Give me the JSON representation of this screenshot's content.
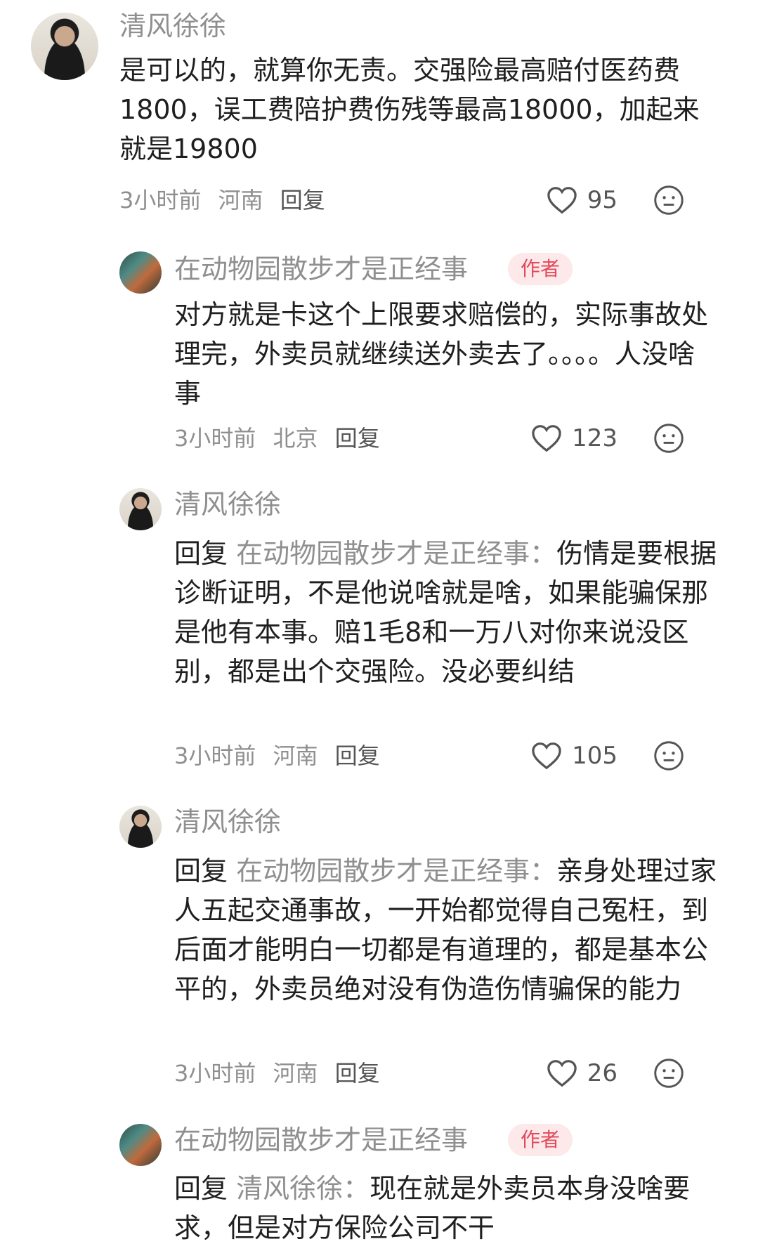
{
  "comments": [
    {
      "user": "清风徐徐",
      "text": "是可以的，就算你无责。交强险最高赔付医药费1800，误工费陪护费伤残等最高18000，加起来就是19800",
      "time": "3小时前",
      "location": "河南",
      "reply_label": "回复",
      "likes": "95"
    },
    {
      "user": "在动物园散步才是正经事",
      "badge": "作者",
      "text": "对方就是卡这个上限要求赔偿的，实际事故处理完，外卖员就继续送外卖去了。。。。人没啥事",
      "time": "3小时前",
      "location": "北京",
      "reply_label": "回复",
      "likes": "123"
    },
    {
      "user": "清风徐徐",
      "reply_prefix": "回复",
      "reply_target": "在动物园散步才是正经事：",
      "text": "伤情是要根据诊断证明，不是他说啥就是啥，如果能骗保那是他有本事。赔1毛8和一万八对你来说没区别，都是出个交强险。没必要纠结",
      "time": "3小时前",
      "location": "河南",
      "reply_label": "回复",
      "likes": "105"
    },
    {
      "user": "清风徐徐",
      "reply_prefix": "回复",
      "reply_target": "在动物园散步才是正经事：",
      "text": "亲身处理过家人五起交通事故，一开始都觉得自己冤枉，到后面才能明白一切都是有道理的，都是基本公平的，外卖员绝对没有伪造伤情骗保的能力",
      "time": "3小时前",
      "location": "河南",
      "reply_label": "回复",
      "likes": "26"
    },
    {
      "user": "在动物园散步才是正经事",
      "badge": "作者",
      "reply_prefix": "回复",
      "reply_target": "清风徐徐：",
      "text": "现在就是外卖员本身没啥要求，但是对方保险公司不干"
    }
  ]
}
